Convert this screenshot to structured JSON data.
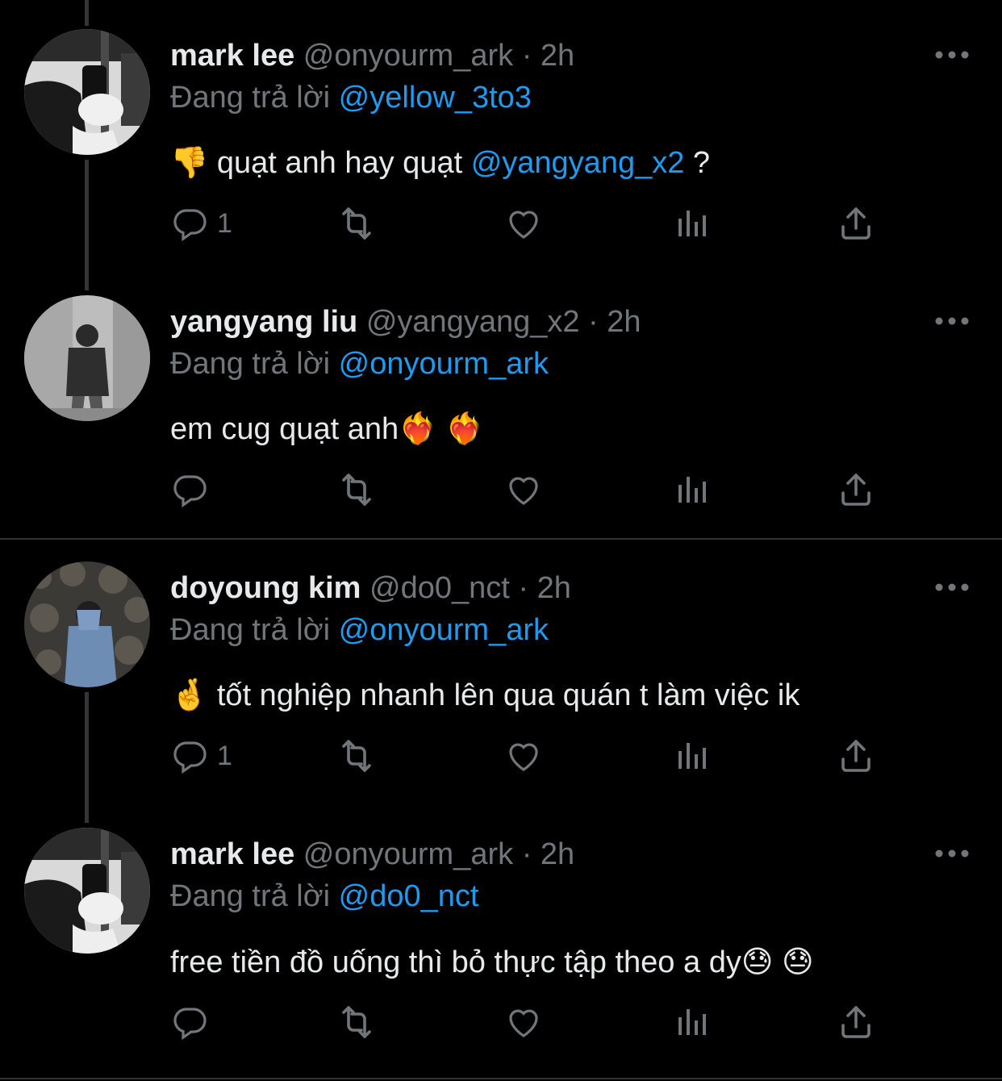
{
  "reply_prefix": "Đang trả lời",
  "tweets": [
    {
      "name": "mark lee",
      "handle": "@onyourm_ark · 2h",
      "reply_to": "@yellow_3to3",
      "emoji": "👎",
      "text_before": " quạt anh hay quạt ",
      "text_mention": "@yangyang_x2",
      "text_after": " ?",
      "reply_count": "1"
    },
    {
      "name": "yangyang liu",
      "handle": "@yangyang_x2 · 2h",
      "reply_to": "@onyourm_ark",
      "text": "em cug quạt anh❤️‍🔥 ❤️‍🔥",
      "reply_count": ""
    },
    {
      "name": "doyoung kim",
      "handle": "@do0_nct · 2h",
      "reply_to": "@onyourm_ark",
      "text": "🤞 tốt nghiệp nhanh lên qua quán t làm việc ik",
      "reply_count": "1"
    },
    {
      "name": "mark lee",
      "handle": "@onyourm_ark · 2h",
      "reply_to": "@do0_nct",
      "text": "free tiền đồ uống thì bỏ thực tập theo a dy😓 😓",
      "reply_count": ""
    }
  ],
  "icons": [
    "reply-icon",
    "retweet-icon",
    "like-icon",
    "views-icon",
    "share-icon",
    "more-icon"
  ],
  "colors": {
    "background": "#000000",
    "text": "#e7e9ea",
    "secondary": "#71767b",
    "mention": "#1d9bf0"
  }
}
